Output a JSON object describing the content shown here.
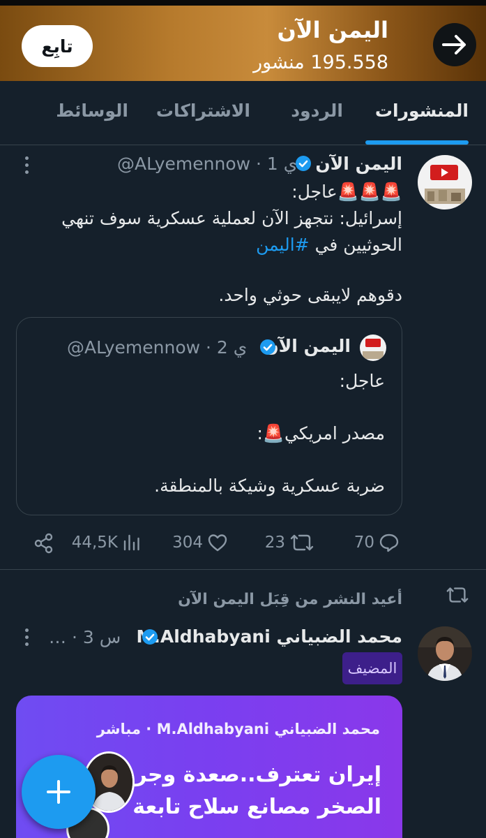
{
  "header": {
    "title": "اليمن الآن",
    "posts_count": "195.558 منشور",
    "follow_label": "تابِع"
  },
  "tabs": [
    {
      "label": "المنشورات",
      "active": true
    },
    {
      "label": "الردود",
      "active": false
    },
    {
      "label": "الاشتراكات",
      "active": false
    },
    {
      "label": "الوسائط",
      "active": false
    }
  ],
  "post1": {
    "author_name": "اليمن الآن",
    "handle_time": "@ALyemennow · 1 ي",
    "line1": "🚨🚨🚨عاجل:",
    "line2": "إسرائيل: نتجهز الآن لعملية عسكرية سوف تنهي",
    "line3_text": "الحوثيين في ",
    "hashtag": "#اليمن",
    "line4": "دقوهم لايبقى حوثي واحد.",
    "quote": {
      "author_name": "اليمن الآن",
      "handle_time": "@ALyemennow · 2 ي",
      "line1": "عاجل:",
      "line2": "مصدر امريكي🚨:",
      "line3": "ضربة عسكرية وشيكة بالمنطقة."
    },
    "stats": {
      "views": "44,5K",
      "likes": "304",
      "reposts": "23",
      "replies": "70"
    }
  },
  "post2": {
    "repost_note": "أعيد النشر من قِبَل اليمن الآن",
    "author_name": "محمد الضبياني M.Aldhabyani",
    "time": "… · 3 س",
    "host_badge": "المضيف",
    "card": {
      "top_line": "محمد الضبياني M.Aldhabyani · مباشر",
      "title_line1": "إيران تعترف..صعدة وجرف",
      "title_line2": "الصخر مصانع سلاح تابعة"
    }
  },
  "colors": {
    "background": "#15202b",
    "accent": "#1d9bf0",
    "verified": "#1d9bf0",
    "space_card": "#7a3ff0"
  }
}
